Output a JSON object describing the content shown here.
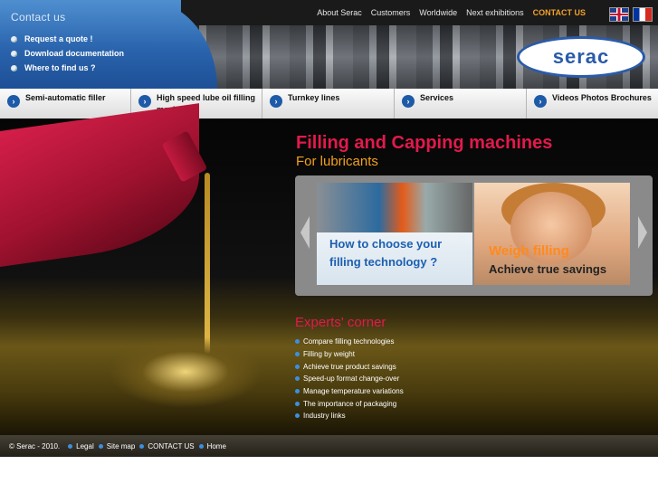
{
  "header": {
    "contact_title": "Contact us",
    "side_links": [
      "Request a quote !",
      "Download documentation",
      "Where to find us ?"
    ],
    "top_nav": [
      "About Serac",
      "Customers",
      "Worldwide",
      "Next exhibitions",
      "CONTACT US"
    ],
    "logo_text": "serac"
  },
  "product_menu": [
    {
      "label": "Semi-automatic filler"
    },
    {
      "label": "High speed lube oil filling machines"
    },
    {
      "label": "Turnkey lines"
    },
    {
      "label": "Services"
    },
    {
      "label": "Videos Photos Brochures"
    }
  ],
  "hero": {
    "headline": "Filling and Capping machines",
    "subline": "For lubricants"
  },
  "slides": [
    {
      "caption": "How to choose your filling technology ?"
    },
    {
      "caption_a": "Weigh filling",
      "caption_b": "Achieve true savings"
    }
  ],
  "experts": {
    "title": "Experts' corner",
    "items": [
      "Compare filling technologies",
      "Filling by weight",
      "Achieve true product savings",
      "Speed-up format change-over",
      "Manage temperature variations",
      "The importance of packaging",
      "Industry links"
    ]
  },
  "footer": {
    "copyright": "© Serac - 2010.",
    "links": [
      "Legal",
      "Site map",
      "CONTACT US",
      "Home"
    ]
  },
  "colors": {
    "brand_blue": "#2a5ba8",
    "headline_red": "#e11a4c",
    "accent_orange": "#f2a01e"
  }
}
